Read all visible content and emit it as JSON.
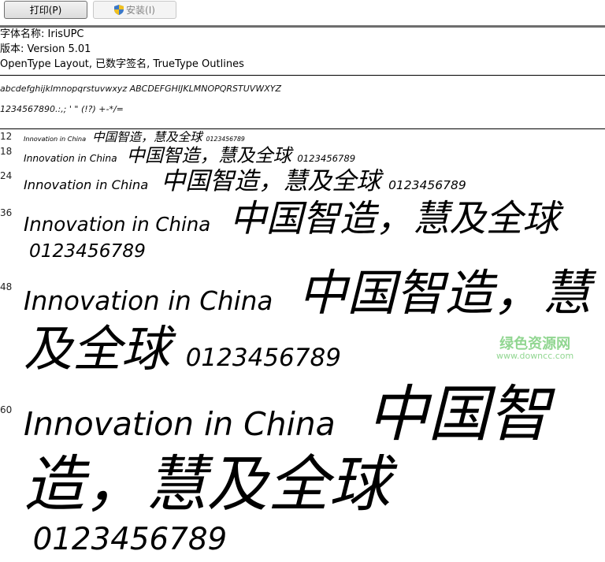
{
  "toolbar": {
    "print_label": "打印(P)",
    "install_label": "安装(I)",
    "install_icon": "uac-shield-icon"
  },
  "info": {
    "font_name": "字体名称: IrisUPC",
    "version": "版本: Version 5.01",
    "details": "OpenType Layout, 已数字签名, TrueType Outlines"
  },
  "samples": {
    "alphabet": "abcdefghijklmnopqrstuvwxyz ABCDEFGHIJKLMNOPQRSTUVWXYZ",
    "symbols": "1234567890.:,; ' \" (!?) +-*/="
  },
  "rows": [
    {
      "size": "12",
      "latin": "Innovation in China",
      "cjk": "中国智造，慧及全球",
      "digits": "0123456789"
    },
    {
      "size": "18",
      "latin": "Innovation in China",
      "cjk": "中国智造，慧及全球",
      "digits": "0123456789"
    },
    {
      "size": "24",
      "latin": "Innovation in China",
      "cjk": "中国智造，慧及全球",
      "digits": "0123456789"
    },
    {
      "size": "36",
      "latin": "Innovation in China",
      "cjk": "中国智造，慧及全球",
      "digits": "0123456789"
    },
    {
      "size": "48",
      "latin": "Innovation in China",
      "cjk": "中国智造，慧及全球",
      "digits": "0123456789"
    },
    {
      "size": "60",
      "latin": "Innovation in China",
      "cjk": "中国智造，慧及全球",
      "digits": "0123456789"
    }
  ],
  "watermark": {
    "line1": "绿色资源网",
    "line2": "www.downcc.com"
  }
}
